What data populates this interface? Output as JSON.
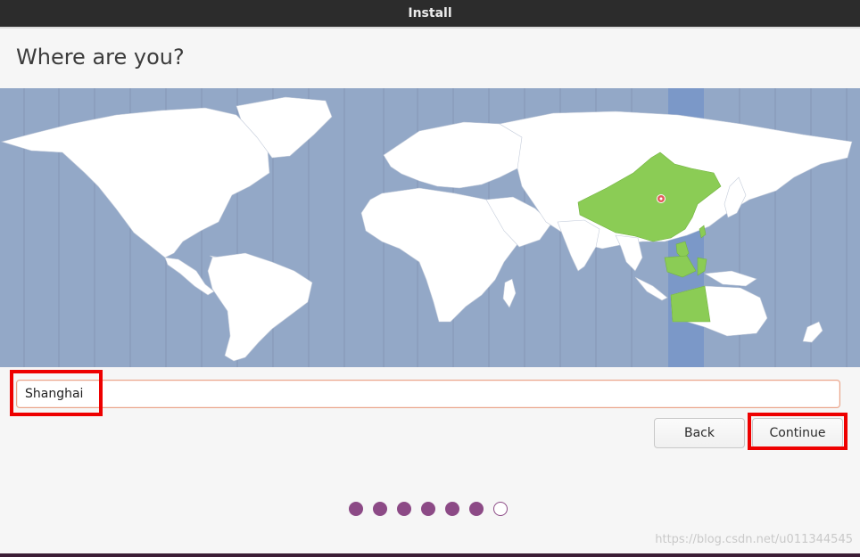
{
  "window": {
    "title": "Install"
  },
  "page": {
    "heading": "Where are you?"
  },
  "location": {
    "value": "Shanghai",
    "selected_region": "China (UTC+08:00)"
  },
  "buttons": {
    "back": "Back",
    "continue": "Continue"
  },
  "progress": {
    "total_steps": 7,
    "completed_steps": 6,
    "current_step": 7
  },
  "watermark": {
    "text": "https://blog.csdn.net/u011344545"
  },
  "colors": {
    "titlebar": "#2c2c2c",
    "ocean": "#93a8c7",
    "land": "#ffffff",
    "highlight_timezone": "#7b98c8",
    "selected_country": "#8bcc55",
    "progress_dot": "#8c4a86",
    "annotation_box": "#ee0000"
  },
  "icons": {
    "location_pin": "map-pin-icon"
  }
}
